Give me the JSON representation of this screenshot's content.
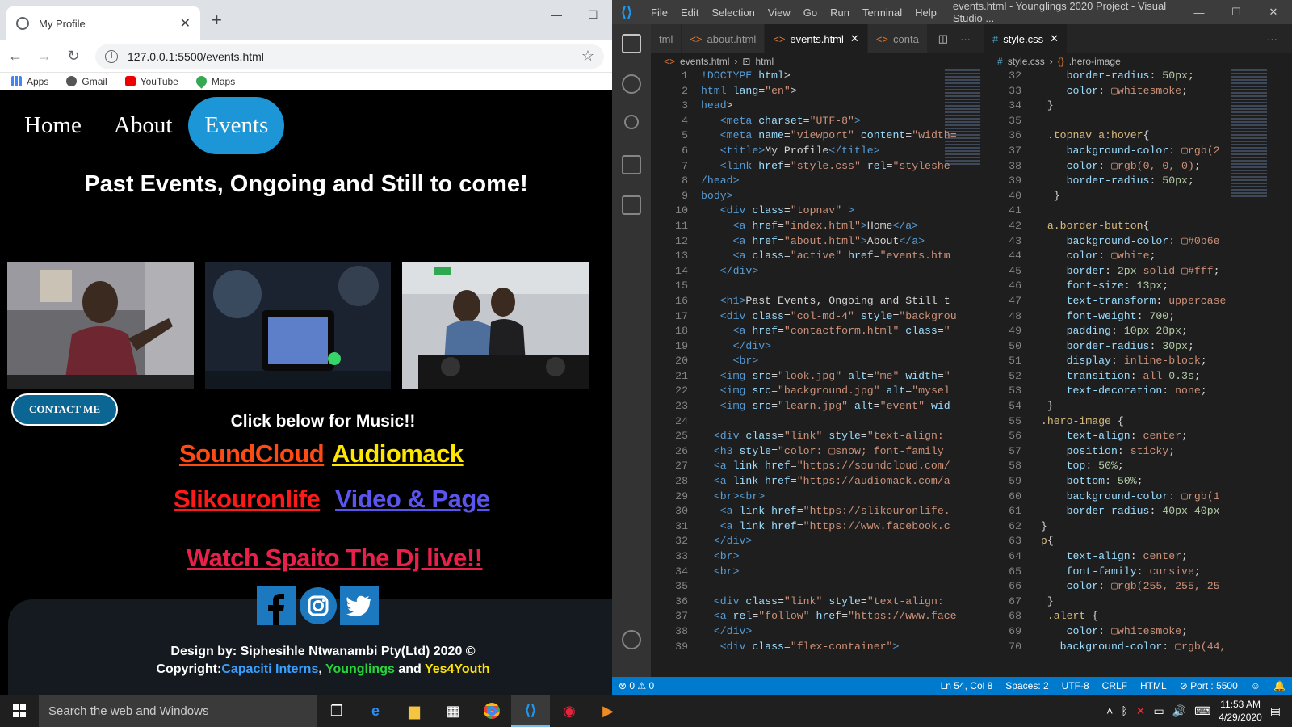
{
  "browser": {
    "tab_title": "My Profile",
    "url": "127.0.0.1:5500/events.html",
    "bookmarks": [
      "Apps",
      "Gmail",
      "YouTube",
      "Maps"
    ]
  },
  "site": {
    "nav": [
      "Home",
      "About",
      "Events"
    ],
    "heading": "Past Events, Ongoing and Still to come!",
    "contact_button": "CONTACT ME",
    "music_heading": "Click below for Music!!",
    "links": [
      {
        "label": "SoundCloud",
        "color": "#ff4a14"
      },
      {
        "label": "Audiomack",
        "color": "#ffe600"
      },
      {
        "label": "Slikouronlife",
        "color": "#ff1a1a"
      },
      {
        "label": "Video & Page",
        "color": "#5b55f0"
      },
      {
        "label": "Watch Spaito The Dj live!!",
        "color": "#e8204a"
      }
    ],
    "credit_line1": "Design by: Siphesihle Ntwanambi Pty(Ltd) 2020 ©",
    "credit_prefix": "Copyright:",
    "credit_a": "Capaciti Interns",
    "credit_comma": ",",
    "credit_b": "Younglings",
    "credit_and": "and",
    "credit_c": "Yes4Youth"
  },
  "vscode": {
    "menu": [
      "File",
      "Edit",
      "Selection",
      "View",
      "Go",
      "Run",
      "Terminal",
      "Help"
    ],
    "window_title": "events.html - Younglings 2020 Project - Visual Studio ...",
    "left_tabs": [
      "tml",
      "about.html",
      "events.html",
      "conta"
    ],
    "left_breadcrumb": [
      "events.html",
      "html"
    ],
    "right_tab": "style.css",
    "right_breadcrumb": [
      "style.css",
      ".hero-image"
    ],
    "status": {
      "problems": "⊗ 0 ⚠ 0",
      "position": "Ln 54, Col 8",
      "spaces": "Spaces: 2",
      "encoding": "UTF-8",
      "eol": "CRLF",
      "language": "HTML",
      "port": "⊘ Port : 5500"
    }
  },
  "taskbar": {
    "search_placeholder": "Search the web and Windows",
    "time": "11:53 AM",
    "date": "4/29/2020"
  }
}
